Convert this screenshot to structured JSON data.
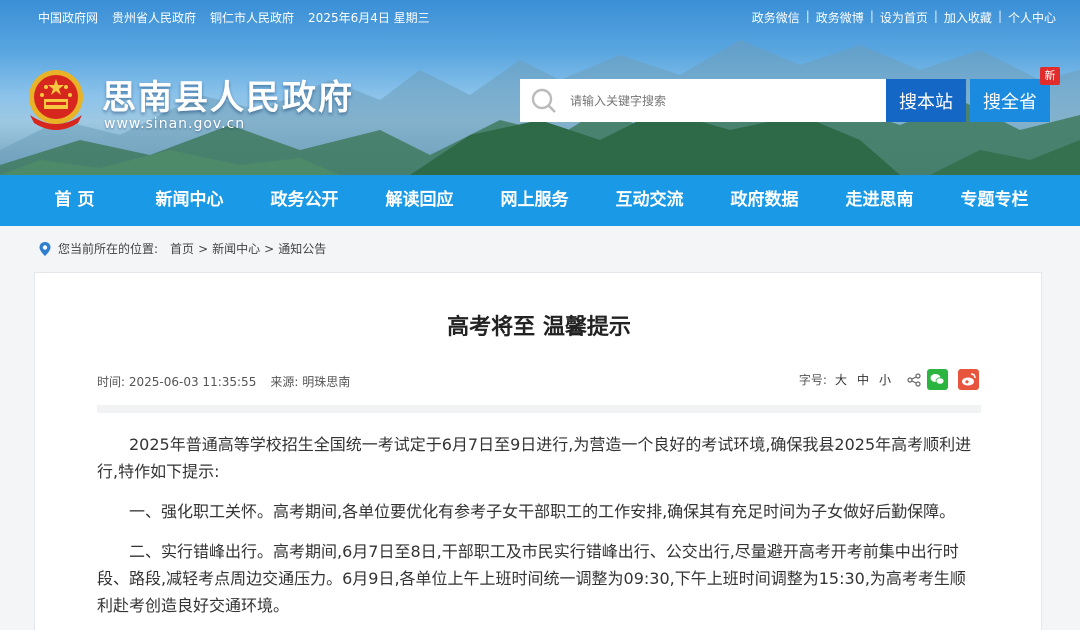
{
  "topbar": {
    "left_links": [
      "中国政府网",
      "贵州省人民政府",
      "铜仁市人民政府",
      "2025年6月4日 星期三"
    ],
    "right_links": [
      "政务微信",
      "政务微博",
      "设为首页",
      "加入收藏",
      "个人中心"
    ]
  },
  "site": {
    "name": "思南县人民政府",
    "url": "www.sinan.gov.cn"
  },
  "search": {
    "placeholder": "请输入关键字搜索",
    "btn_site": "搜本站",
    "btn_province": "搜全省",
    "new_badge": "新"
  },
  "nav": {
    "items": [
      "首 页",
      "新闻中心",
      "政务公开",
      "解读回应",
      "网上服务",
      "互动交流",
      "政府数据",
      "走进思南",
      "专题专栏"
    ]
  },
  "breadcrumb": {
    "label": "您当前所在的位置:",
    "items": [
      "首页",
      ">",
      "新闻中心",
      ">",
      "通知公告"
    ]
  },
  "article": {
    "title": "高考将至 温馨提示",
    "time_label": "时间:",
    "time": "2025-06-03 11:35:55",
    "source_label": "来源:",
    "source": "明珠思南",
    "fontsize_label": "字号:",
    "fontsize_options": [
      "大",
      "中",
      "小"
    ],
    "paragraphs": [
      "2025年普通高等学校招生全国统一考试定于6月7日至9日进行,为营造一个良好的考试环境,确保我县2025年高考顺利进行,特作如下提示:",
      "一、强化职工关怀。高考期间,各单位要优化有参考子女干部职工的工作安排,确保其有充足时间为子女做好后勤保障。",
      "二、实行错峰出行。高考期间,6月7日至8日,干部职工及市民实行错峰出行、公交出行,尽量避开高考开考前集中出行时段、路段,减轻考点周边交通压力。6月9日,各单位上午上班时间统一调整为09:30,下午上班时间调整为15:30,为高考考生顺利赴考创造良好交通环境。"
    ]
  },
  "colors": {
    "nav_bg": "#1a9ae6",
    "btn_site": "#1567c6",
    "btn_province": "#1b8be0",
    "badge": "#e22c2c",
    "wechat": "#2bb540",
    "weibo": "#e8553f"
  },
  "icons": [
    "national-emblem-icon",
    "search-icon",
    "location-pin-icon",
    "share-icon",
    "wechat-icon",
    "weibo-icon"
  ]
}
